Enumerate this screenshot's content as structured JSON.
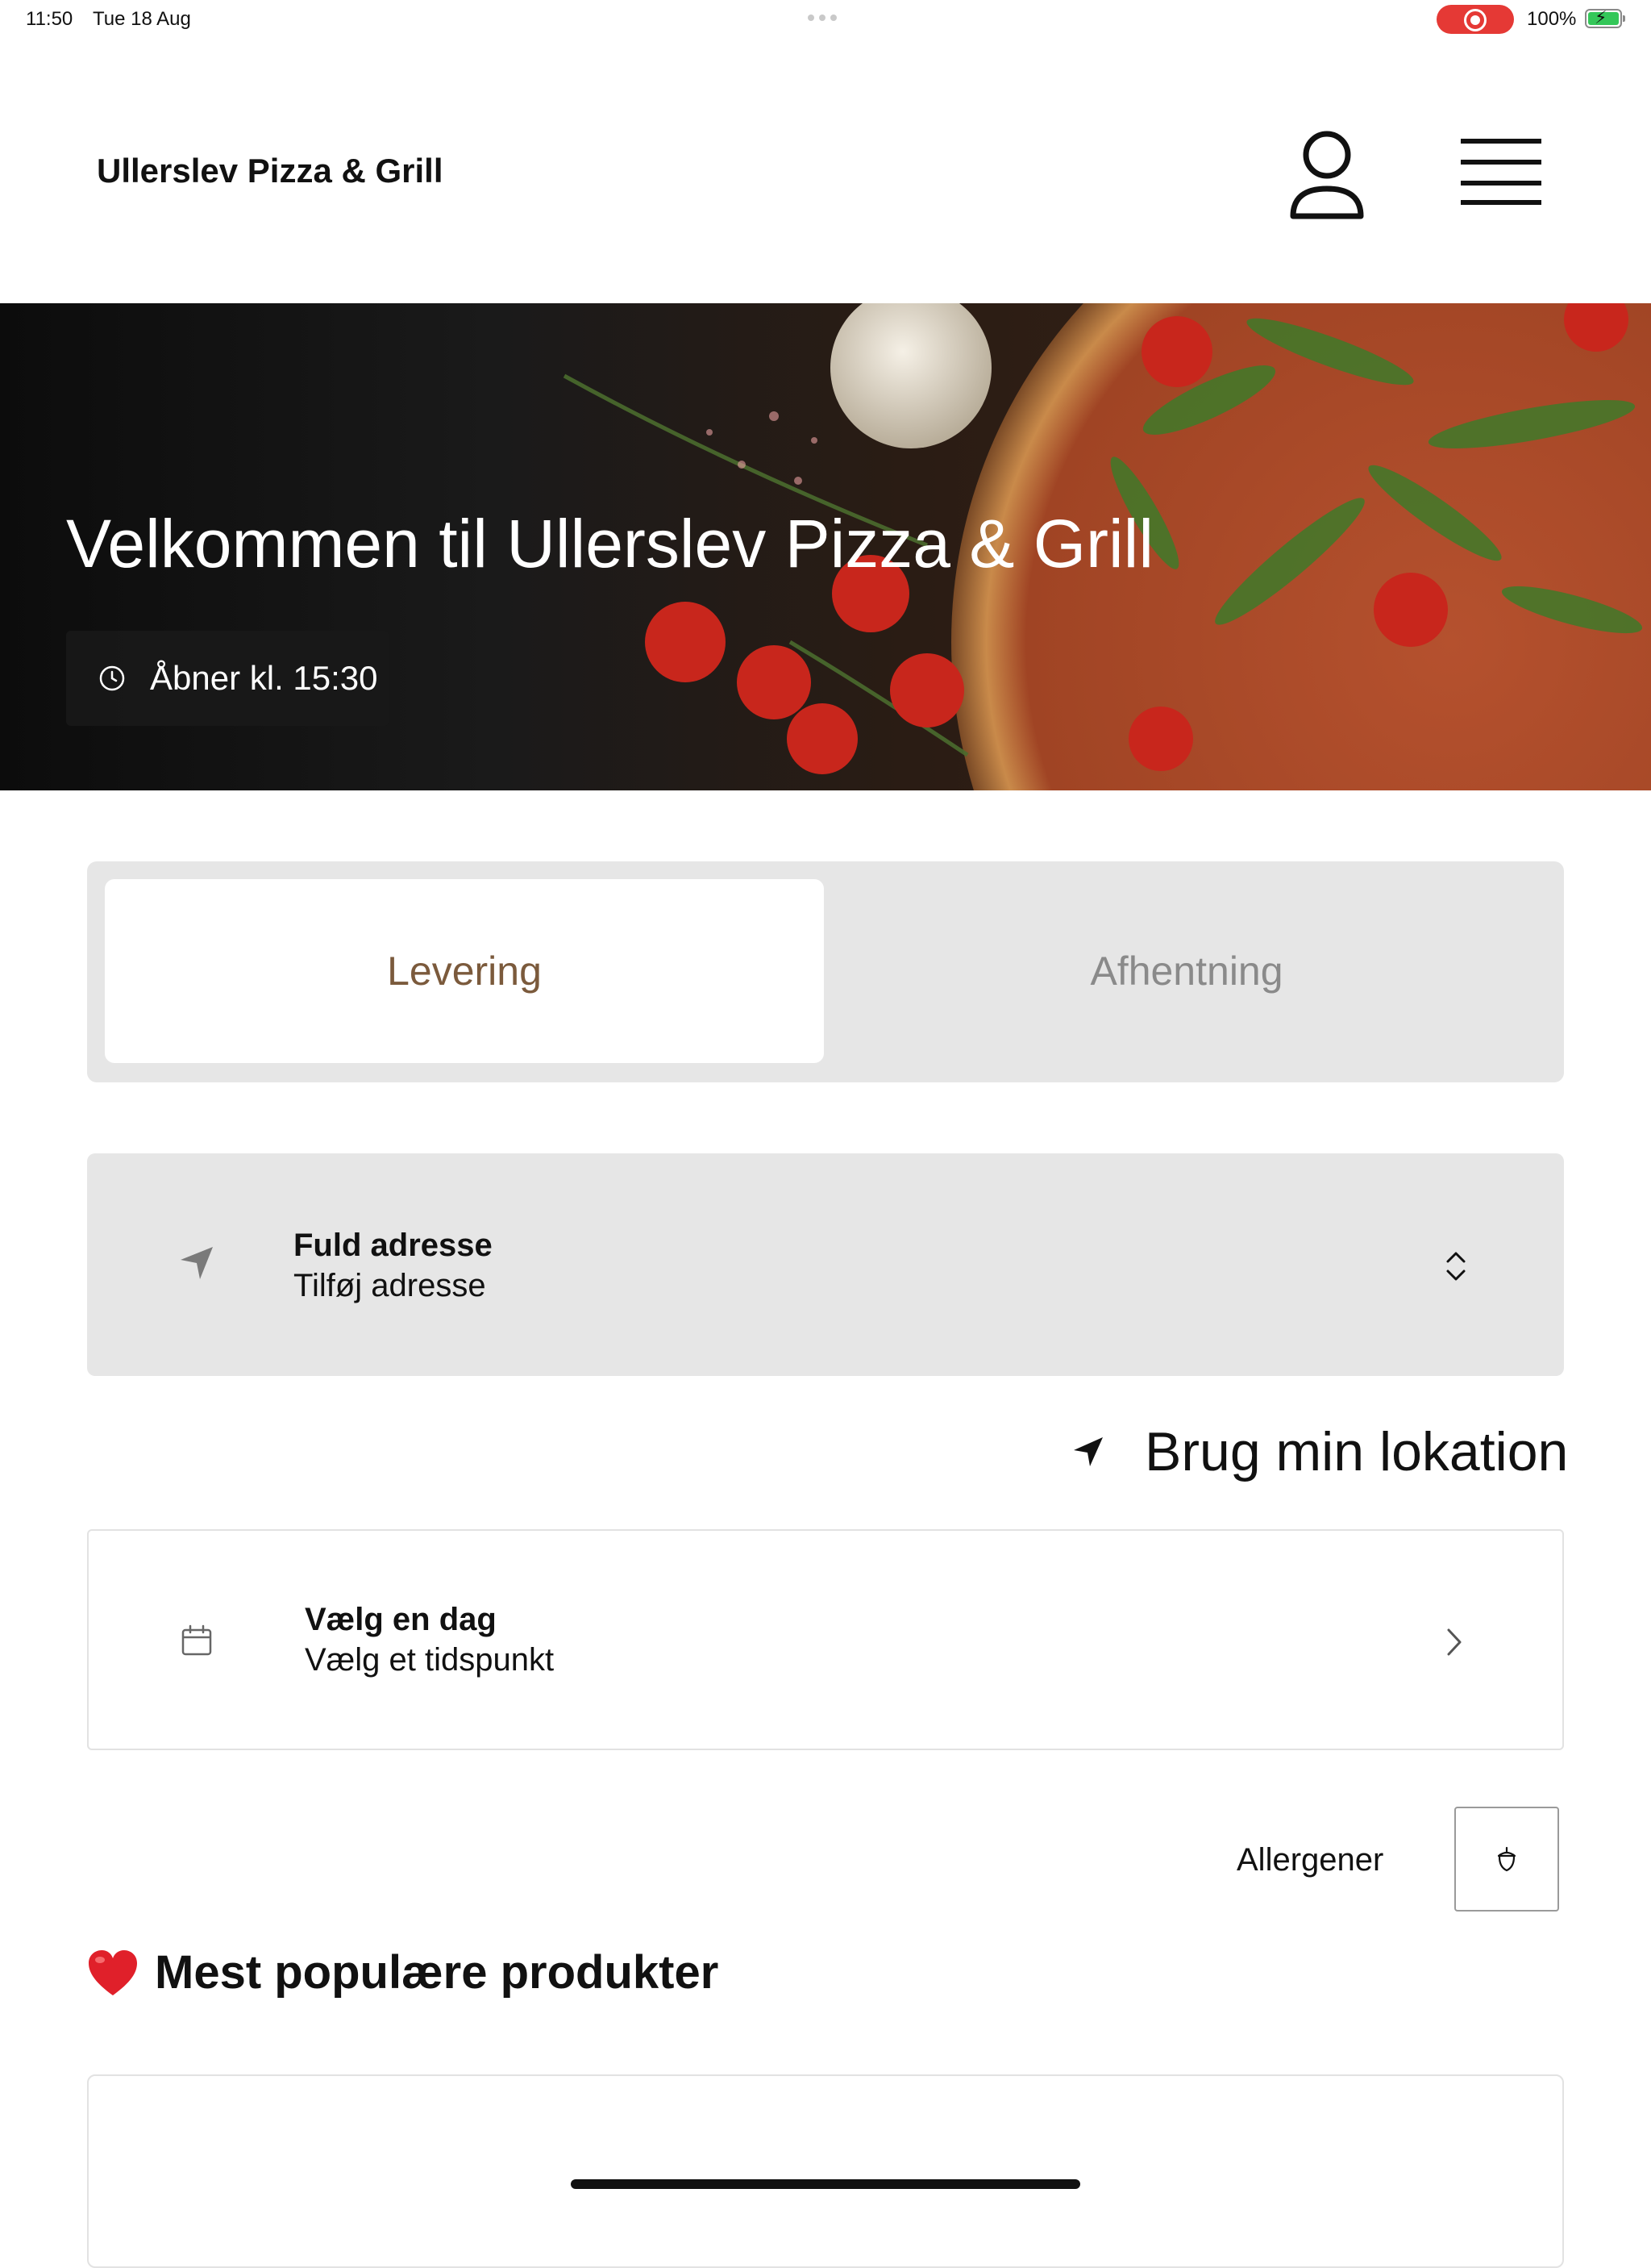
{
  "status_bar": {
    "time": "11:50",
    "date": "Tue 18 Aug",
    "battery_percent": "100%",
    "recording_color": "#e53935",
    "battery_level": 1.0
  },
  "header": {
    "brand": "Ullerslev Pizza & Grill",
    "user_icon": "user-icon",
    "menu_icon": "menu-icon"
  },
  "hero": {
    "title": "Velkommen til Ullerslev Pizza & Grill",
    "open_badge": "Åbner kl. 15:30",
    "badge_icon": "clock-icon"
  },
  "order_type": {
    "tabs": [
      {
        "label": "Levering",
        "selected": true
      },
      {
        "label": "Afhentning",
        "selected": false
      }
    ],
    "active_color": "#7b5a3c"
  },
  "address": {
    "title": "Fuld adresse",
    "placeholder": "Tilføj adresse",
    "icon": "navigation-arrow-icon"
  },
  "location": {
    "label": "Brug min lokation",
    "icon": "location-arrow-icon"
  },
  "date_picker": {
    "title": "Vælg en dag",
    "subtitle": "Vælg et tidspunkt",
    "icon": "calendar-icon"
  },
  "allergens": {
    "label": "Allergener",
    "icon": "acorn-icon"
  },
  "popular": {
    "emoji": "❤️",
    "title": "Mest populære produkter"
  }
}
